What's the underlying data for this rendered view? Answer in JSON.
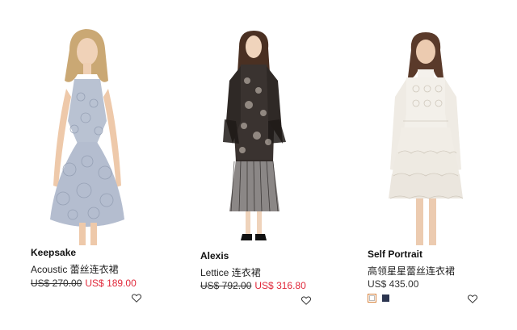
{
  "products": [
    {
      "brand": "Keepsake",
      "description": "Acoustic 蕾丝连衣裙",
      "original_price": "US$ 270.00",
      "sale_price": "US$ 189.00",
      "image_alt": "Keepsake Acoustic 蕾丝连衣裙",
      "wishlist_icon": "heart-outline-icon"
    },
    {
      "brand": "Alexis",
      "description": "Lettice 连衣裙",
      "original_price": "US$ 792.00",
      "sale_price": "US$ 316.80",
      "image_alt": "Alexis Lettice 连衣裙",
      "wishlist_icon": "heart-outline-icon"
    },
    {
      "brand": "Self Portrait",
      "description": "高领星星蕾丝连衣裙",
      "price": "US$ 435.00",
      "image_alt": "Self Portrait 高领星星蕾丝连衣裙",
      "wishlist_icon": "heart-outline-icon",
      "swatches": [
        {
          "color": "#ffffff",
          "selected": true
        },
        {
          "color": "#2c3550",
          "selected": false
        }
      ]
    }
  ],
  "colors": {
    "sale": "#e0283a",
    "text": "#222222",
    "swatch_selected_border": "#d7823c"
  }
}
